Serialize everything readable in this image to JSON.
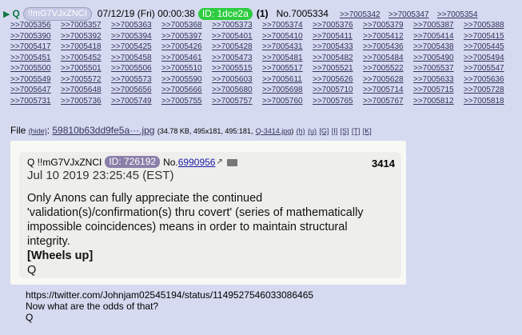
{
  "header": {
    "name": "Q",
    "tripcode": "!!mG7VJxZNCI",
    "date": "07/12/19 (Fri) 00:00:38",
    "id": "ID: 1dce2a",
    "count": "(1)",
    "post_no": "No.7005334",
    "refs": [
      ">>7005342",
      ">>7005347",
      ">>7005354"
    ]
  },
  "refs": [
    ">>7005356",
    ">>7005357",
    ">>7005363",
    ">>7005368",
    ">>7005373",
    ">>7005374",
    ">>7005376",
    ">>7005379",
    ">>7005387",
    ">>7005388",
    ">>7005390",
    ">>7005392",
    ">>7005394",
    ">>7005397",
    ">>7005401",
    ">>7005410",
    ">>7005411",
    ">>7005412",
    ">>7005414",
    ">>7005415",
    ">>7005417",
    ">>7005418",
    ">>7005425",
    ">>7005426",
    ">>7005428",
    ">>7005431",
    ">>7005433",
    ">>7005436",
    ">>7005438",
    ">>7005445",
    ">>7005451",
    ">>7005452",
    ">>7005458",
    ">>7005461",
    ">>7005473",
    ">>7005481",
    ">>7005482",
    ">>7005484",
    ">>7005490",
    ">>7005494",
    ">>7005500",
    ">>7005501",
    ">>7005506",
    ">>7005510",
    ">>7005515",
    ">>7005517",
    ">>7005521",
    ">>7005522",
    ">>7005537",
    ">>7005547",
    ">>7005549",
    ">>7005572",
    ">>7005573",
    ">>7005590",
    ">>7005603",
    ">>7005611",
    ">>7005626",
    ">>7005628",
    ">>7005633",
    ">>7005636",
    ">>7005647",
    ">>7005648",
    ">>7005656",
    ">>7005666",
    ">>7005680",
    ">>7005698",
    ">>7005710",
    ">>7005714",
    ">>7005715",
    ">>7005728",
    ">>7005731",
    ">>7005736",
    ">>7005749",
    ">>7005755",
    ">>7005757",
    ">>7005760",
    ">>7005765",
    ">>7005767",
    ">>7005812",
    ">>7005818"
  ],
  "file": {
    "label": "File",
    "hide": "(hide)",
    "filename": "59810b63dd9fe5a···.jpg",
    "meta": "(34.78 KB, 495x181, 495:181,",
    "orig": "Q-3414.jpg",
    "links": [
      "(h)",
      "(u)",
      "[G]",
      "[I]",
      "[S]",
      "[T]",
      "[K]"
    ],
    "close_paren": ")"
  },
  "quote": {
    "name": "Q !!mG7VJxZNCI",
    "id": "ID: 726192",
    "no_prefix": "No.",
    "no": "6990956",
    "number": "3414",
    "date": "Jul 10 2019 23:25:45 (EST)",
    "body": [
      "Only Anons can fully appreciate the continued",
      "'validation(s)/confirmation(s) thru covert' (series of mathematically",
      "impossible coincidences) means in order to maintain structural",
      "integrity."
    ],
    "bold": "[Wheels up]",
    "sign": "Q"
  },
  "reply": {
    "url": "https://twitter.com/Johnjam02545194/status/1149527546033086465",
    "line2": "Now what are the odds of that?",
    "sign": "Q"
  },
  "colors": {
    "background": "#d6daf0",
    "id_badge": "#2ecc40",
    "name": "#117743",
    "link": "#34345c"
  }
}
